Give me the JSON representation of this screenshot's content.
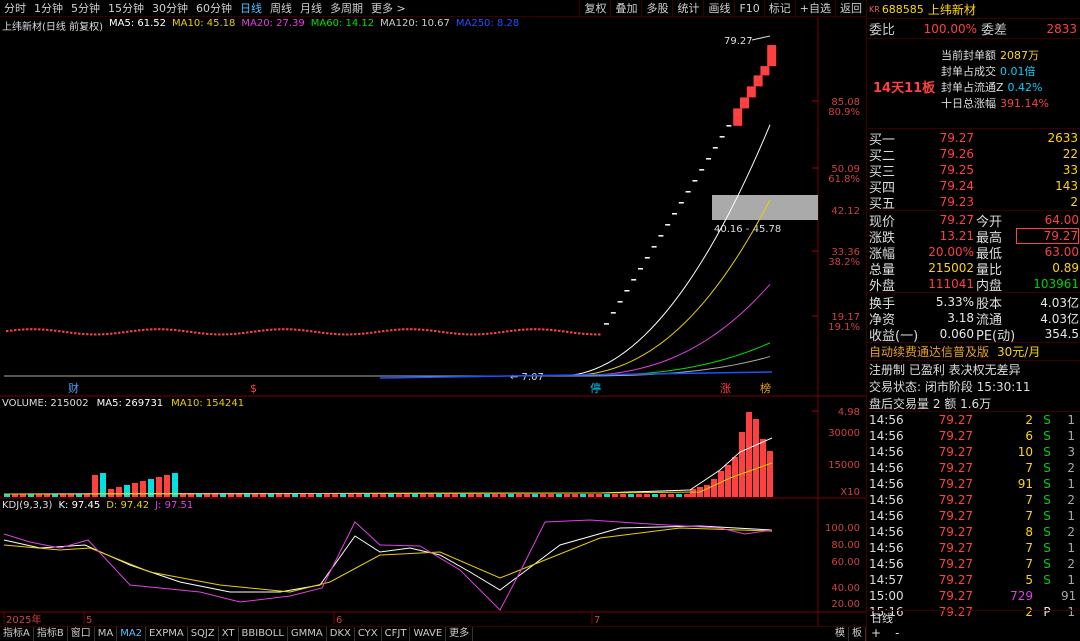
{
  "toolbar": {
    "periods": [
      "分时",
      "1分钟",
      "5分钟",
      "15分钟",
      "30分钟",
      "60分钟",
      "日线",
      "周线",
      "月线",
      "多周期",
      "更多 >"
    ],
    "active_period": "日线",
    "right_buttons": [
      "复权",
      "叠加",
      "多股",
      "统计",
      "画线",
      "F10",
      "标记",
      "+自选",
      "返回"
    ]
  },
  "main_legend": {
    "title": "上纬新材(日线 前复权)",
    "ma5": "MA5: 61.52",
    "ma10": "MA10: 45.18",
    "ma20": "MA20: 27.39",
    "ma60": "MA60: 14.12",
    "ma120": "MA120: 10.67",
    "ma250": "MA250: 8.28"
  },
  "price_axis": [
    {
      "v": "85.08",
      "p": "80.9%"
    },
    {
      "v": "50.09",
      "p": "61.8%"
    },
    {
      "v": "42.12",
      "p": ""
    },
    {
      "v": "33.36",
      "p": "38.2%"
    },
    {
      "v": "19.17",
      "p": "19.1%"
    },
    {
      "v": "4.98",
      "p": ""
    }
  ],
  "annotations": {
    "high": "79.27",
    "gap": "40.16 - 45.78",
    "low": "← 7.07",
    "markers": [
      "财",
      "$",
      "停",
      "涨",
      "榜"
    ]
  },
  "volume_legend": {
    "label": "VOLUME: 215002",
    "ma5": "MA5: 269731",
    "ma10": "MA10: 154241"
  },
  "volume_axis": [
    "30000",
    "15000",
    "X10"
  ],
  "kdj_legend": {
    "label": "KDJ(9,3,3)",
    "k": "K: 97.45",
    "d": "D: 97.42",
    "j": "J: 97.51"
  },
  "kdj_axis": [
    "100.00",
    "80.00",
    "60.00",
    "40.00",
    "20.00",
    "0.00"
  ],
  "date_axis": [
    "2025年",
    "5",
    "6",
    "7"
  ],
  "bottom_tabs": [
    "指标A",
    "指标B",
    "窗口",
    "MA",
    "MA2",
    "EXPMA",
    "SQJZ",
    "XT",
    "BBIBOLL",
    "GMMA",
    "DKX",
    "CYX",
    "CFJT",
    "WAVE",
    "更多"
  ],
  "bottom_active": "MA2",
  "bottom_right": [
    "模",
    "板"
  ],
  "chart_data": {
    "type": "candlestick",
    "title": "上纬新材(日线 前复权)",
    "last_close": 79.27,
    "recent_closes": [
      7.07,
      7.78,
      8.56,
      9.42,
      10.36,
      11.4,
      12.54,
      13.79,
      15.17,
      16.69,
      18.36,
      20.2,
      22.22,
      24.44,
      26.88,
      29.57,
      32.53,
      35.78,
      39.36,
      45.78,
      50.36,
      55.4,
      60.94,
      66.06,
      79.27
    ]
  },
  "side": {
    "kr": "KR",
    "code": "688585",
    "name": "上纬新材",
    "weibi_label": "委比",
    "weibi_value": "100.00%",
    "weicha_label": "委差",
    "weicha_value": "2833",
    "board_label": "14天11板",
    "seal_rows": [
      {
        "label": "当前封单额",
        "value": "2087万"
      },
      {
        "label": "封单占成交",
        "value": "0.01倍"
      },
      {
        "label": "封单占流通Z",
        "value": "0.42%"
      },
      {
        "label": "十日总涨幅",
        "value": "391.14%"
      }
    ],
    "buys": [
      {
        "label": "买一",
        "price": "79.27",
        "vol": "2633"
      },
      {
        "label": "买二",
        "price": "79.26",
        "vol": "22"
      },
      {
        "label": "买三",
        "price": "79.25",
        "vol": "33"
      },
      {
        "label": "买四",
        "price": "79.24",
        "vol": "143"
      },
      {
        "label": "买五",
        "price": "79.23",
        "vol": "2"
      }
    ],
    "quote": [
      {
        "l1": "现价",
        "v1": "79.27",
        "l2": "今开",
        "v2": "64.00"
      },
      {
        "l1": "涨跌",
        "v1": "13.21",
        "l2": "最高",
        "v2": "79.27"
      },
      {
        "l1": "涨幅",
        "v1": "20.00%",
        "l2": "最低",
        "v2": "63.00"
      },
      {
        "l1": "总量",
        "v1": "215002",
        "l2": "量比",
        "v2": "0.89"
      },
      {
        "l1": "外盘",
        "v1": "111041",
        "l2": "内盘",
        "v2": "103961"
      }
    ],
    "fund": [
      {
        "l1": "换手",
        "v1": "5.33%",
        "l2": "股本",
        "v2": "4.03亿"
      },
      {
        "l1": "净资",
        "v1": "3.18",
        "l2": "流通",
        "v2": "4.03亿"
      },
      {
        "l1": "收益(一)",
        "v1": "0.060",
        "l2": "PE(动)",
        "v2": "354.5"
      }
    ],
    "promo": "自动续费通达信普及版",
    "promo_price": "30元/月",
    "tags": "注册制 已盈利 表决权无差异",
    "status": "交易状态: 闭市阶段 15:30:11",
    "after": "盘后交易量 2 额 1.6万",
    "ticks": [
      {
        "t": "14:56",
        "p": "79.27",
        "v": "2",
        "s": "S",
        "n": "1"
      },
      {
        "t": "14:56",
        "p": "79.27",
        "v": "6",
        "s": "S",
        "n": "1"
      },
      {
        "t": "14:56",
        "p": "79.27",
        "v": "10",
        "s": "S",
        "n": "3"
      },
      {
        "t": "14:56",
        "p": "79.27",
        "v": "7",
        "s": "S",
        "n": "2"
      },
      {
        "t": "14:56",
        "p": "79.27",
        "v": "91",
        "s": "S",
        "n": "1"
      },
      {
        "t": "14:56",
        "p": "79.27",
        "v": "7",
        "s": "S",
        "n": "2"
      },
      {
        "t": "14:56",
        "p": "79.27",
        "v": "7",
        "s": "S",
        "n": "1"
      },
      {
        "t": "14:56",
        "p": "79.27",
        "v": "8",
        "s": "S",
        "n": "2"
      },
      {
        "t": "14:56",
        "p": "79.27",
        "v": "7",
        "s": "S",
        "n": "1"
      },
      {
        "t": "14:56",
        "p": "79.27",
        "v": "7",
        "s": "S",
        "n": "2"
      },
      {
        "t": "14:57",
        "p": "79.27",
        "v": "5",
        "s": "S",
        "n": "1"
      },
      {
        "t": "15:00",
        "p": "79.27",
        "v": "729",
        "s": "",
        "n": "91"
      },
      {
        "t": "15:16",
        "p": "79.27",
        "v": "2",
        "s": "P",
        "n": "1"
      }
    ],
    "period_label": "日线",
    "bottom_icons": [
      "+",
      "-"
    ]
  },
  "colors": {
    "up": "#ff4040",
    "down": "#00e0e0",
    "ma5": "#ffffff",
    "ma10": "#e8d000",
    "ma20": "#e040e0",
    "ma60": "#00e000",
    "ma120": "#a0a0a0",
    "ma250": "#2050ff"
  }
}
